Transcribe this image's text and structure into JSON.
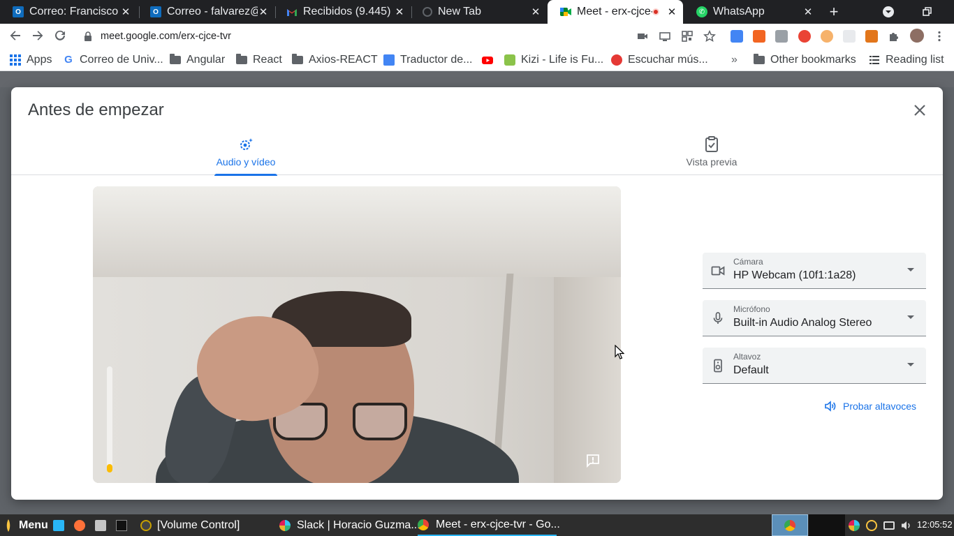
{
  "browser": {
    "tabs": [
      {
        "title": "Correo: Francisco",
        "icon": "outlook-icon"
      },
      {
        "title": "Correo - falvarez@",
        "icon": "outlook-icon"
      },
      {
        "title": "Recibidos (9.445)",
        "icon": "gmail-icon"
      },
      {
        "title": "New Tab",
        "icon": "globe-icon"
      },
      {
        "title": "Meet - erx-cjce-",
        "icon": "meet-icon",
        "active": true
      },
      {
        "title": "WhatsApp",
        "icon": "whatsapp-icon"
      }
    ],
    "url": "meet.google.com/erx-cjce-tvr",
    "bookmarks": [
      {
        "label": "Apps"
      },
      {
        "label": "Correo de Univ..."
      },
      {
        "label": "Angular"
      },
      {
        "label": "React"
      },
      {
        "label": "Axios-REACT"
      },
      {
        "label": "Traductor de..."
      },
      {
        "label": "Kizi - Life is Fu..."
      },
      {
        "label": "Escuchar mús..."
      },
      {
        "label": "Other bookmarks"
      },
      {
        "label": "Reading list"
      }
    ]
  },
  "dialog": {
    "title": "Antes de empezar",
    "tabs": [
      {
        "label": "Audio y vídeo",
        "icon": "audio-video-settings-icon",
        "selected": true
      },
      {
        "label": "Vista previa",
        "icon": "clipboard-check-icon",
        "selected": false
      }
    ],
    "mic_level": 0.08,
    "devices": {
      "camera": {
        "label": "Cámara",
        "value": "HP Webcam (10f1:1a28)",
        "icon": "videocam-icon"
      },
      "microphone": {
        "label": "Micrófono",
        "value": "Built-in Audio Analog Stereo",
        "icon": "mic-icon"
      },
      "speaker": {
        "label": "Altavoz",
        "value": "Default",
        "icon": "speaker-icon"
      }
    },
    "test_speakers_label": "Probar altavoces"
  },
  "taskbar": {
    "menu_label": "Menu",
    "windows": [
      {
        "label": "[Volume Control]"
      },
      {
        "label": "Slack | Horacio Guzma..."
      },
      {
        "label": "Meet - erx-cjce-tvr - Go..."
      }
    ],
    "clock": "12:05:52"
  },
  "colors": {
    "accent": "#1a73e8",
    "mic_level": "#fbbc04",
    "tabstrip": "#202124"
  }
}
